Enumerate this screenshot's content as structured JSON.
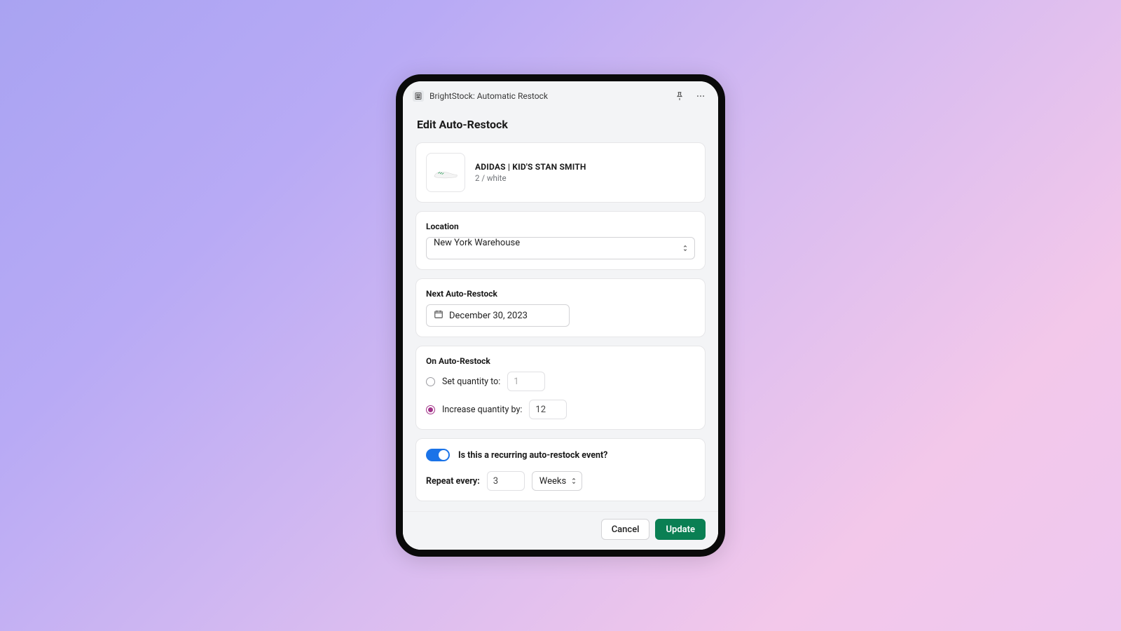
{
  "topbar": {
    "app_title": "BrightStock: Automatic Restock"
  },
  "page": {
    "title": "Edit Auto-Restock"
  },
  "product": {
    "name": "ADIDAS | KID'S STAN SMITH",
    "variant": "2 / white"
  },
  "location": {
    "label": "Location",
    "value": "New York Warehouse"
  },
  "next_restock": {
    "label": "Next Auto-Restock",
    "value": "December 30, 2023"
  },
  "on_restock": {
    "label": "On Auto-Restock",
    "set_label": "Set quantity to:",
    "set_value": "1",
    "increase_label": "Increase quantity by:",
    "increase_value": "12",
    "selected": "increase"
  },
  "recurring": {
    "toggle_label": "Is this a recurring auto-restock event?",
    "enabled": true,
    "repeat_label": "Repeat every:",
    "repeat_value": "3",
    "repeat_unit": "Weeks"
  },
  "footer": {
    "cancel": "Cancel",
    "update": "Update"
  }
}
